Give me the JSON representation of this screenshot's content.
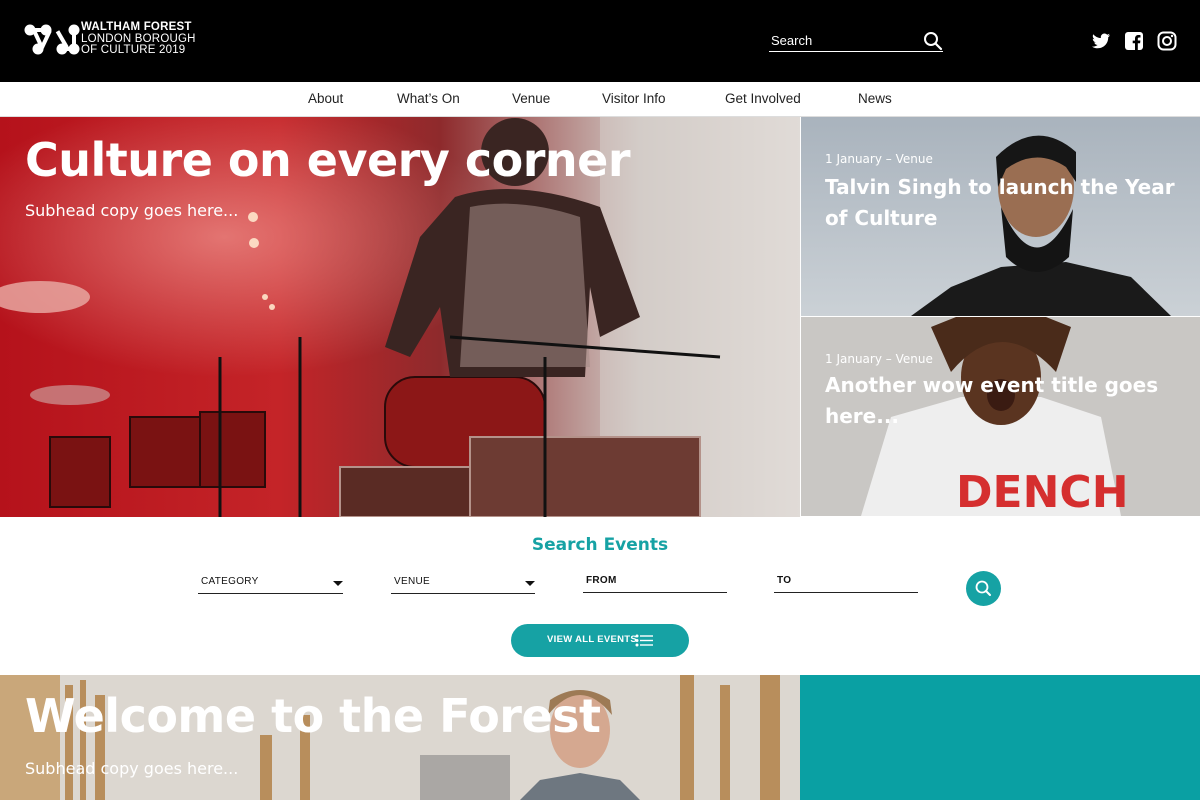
{
  "header": {
    "brand_line1": "WALTHAM FOREST",
    "brand_line2": "LONDON BOROUGH",
    "brand_line3": "OF CULTURE 2019",
    "search_placeholder": "Search",
    "social_icons": [
      "twitter-icon",
      "facebook-icon",
      "instagram-icon"
    ]
  },
  "nav": {
    "items": [
      {
        "label": "About"
      },
      {
        "label": "What’s On"
      },
      {
        "label": "Venue"
      },
      {
        "label": "Visitor Info"
      },
      {
        "label": "Get Involved"
      },
      {
        "label": "News"
      }
    ]
  },
  "hero": {
    "title": "Culture on every corner",
    "subtitle": "Subhead copy goes here..."
  },
  "cards": [
    {
      "meta": "1 January – Venue",
      "title": "Talvin Singh to launch the Year of Culture"
    },
    {
      "meta": "1 January – Venue",
      "title": "Another wow event title goes here..."
    }
  ],
  "search_events": {
    "title": "Search Events",
    "filters": {
      "category": "CATEGORY",
      "venue": "VENUE",
      "from": "FROM",
      "to": "TO"
    },
    "view_all_label": "VIEW ALL EVENTS"
  },
  "welcome": {
    "title": "Welcome to the Forest",
    "subtitle": "Subhead copy goes here..."
  },
  "colors": {
    "accent": "#16a2a4",
    "header_bg": "#000000",
    "teal_block": "#0aa0a3"
  }
}
